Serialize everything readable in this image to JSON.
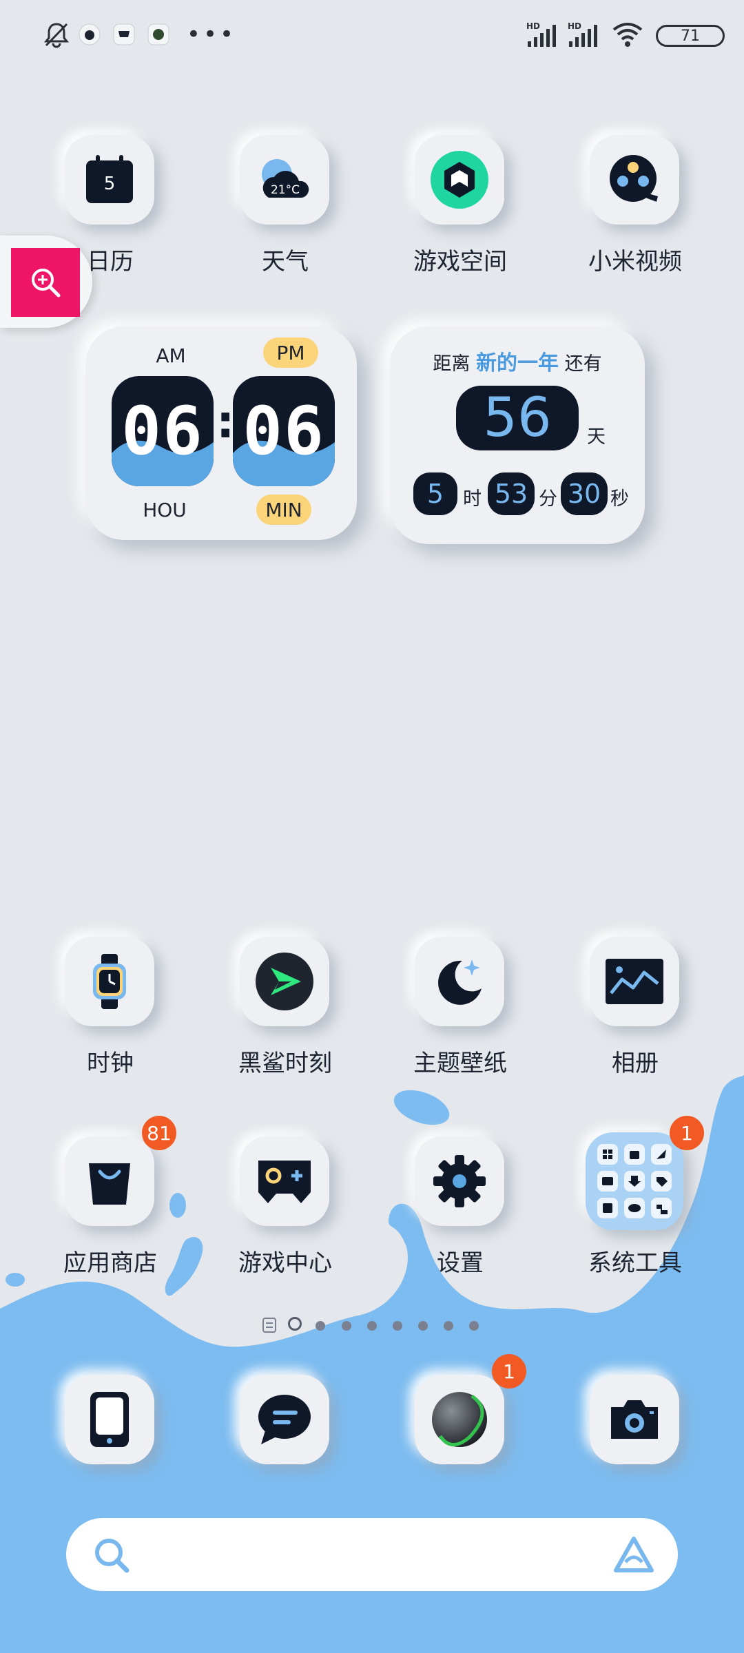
{
  "status_bar": {
    "icons": [
      "bell-off-icon",
      "app-notification-icon",
      "shopping-notification-icon",
      "camera-notification-icon"
    ],
    "more": "•••",
    "signal": [
      "HD",
      "HD"
    ],
    "battery": "71"
  },
  "row1": [
    {
      "name": "日历",
      "icon": "calendar-icon",
      "day": "5"
    },
    {
      "name": "天气",
      "icon": "weather-icon",
      "temp": "21°C"
    },
    {
      "name": "游戏空间",
      "icon": "game-space-icon"
    },
    {
      "name": "小米视频",
      "icon": "video-reel-icon"
    }
  ],
  "clock_widget": {
    "am": "AM",
    "pm": "PM",
    "hours": "06",
    "minutes": "06",
    "hour_label": "HOU",
    "min_label": "MIN"
  },
  "countdown_widget": {
    "prefix": "距离",
    "highlight": "新的一年",
    "suffix": "还有",
    "days": "56",
    "days_unit": "天",
    "hours": "5",
    "hours_unit": "时",
    "minutes": "53",
    "minutes_unit": "分",
    "seconds": "30",
    "seconds_unit": "秒"
  },
  "row2": [
    {
      "name": "时钟",
      "icon": "watch-icon"
    },
    {
      "name": "黑鲨时刻",
      "icon": "black-shark-icon"
    },
    {
      "name": "主题壁纸",
      "icon": "moon-star-icon"
    },
    {
      "name": "相册",
      "icon": "gallery-icon"
    }
  ],
  "row3": [
    {
      "name": "应用商店",
      "icon": "shopping-bag-icon",
      "badge": "81"
    },
    {
      "name": "游戏中心",
      "icon": "gamepad-icon"
    },
    {
      "name": "设置",
      "icon": "gear-icon"
    },
    {
      "name": "系统工具",
      "icon": "folder-grid-icon",
      "badge": "1"
    }
  ],
  "dock": [
    {
      "icon": "phone-icon"
    },
    {
      "icon": "message-icon"
    },
    {
      "icon": "browser-icon",
      "badge": "1"
    },
    {
      "icon": "camera-icon"
    }
  ],
  "colors": {
    "background": "#e4e7eb",
    "accent_blue": "#7dbcf0",
    "dark": "#0f1828",
    "badge": "#f15a22",
    "pink": "#ee1566",
    "yellow": "#fbd47a"
  }
}
